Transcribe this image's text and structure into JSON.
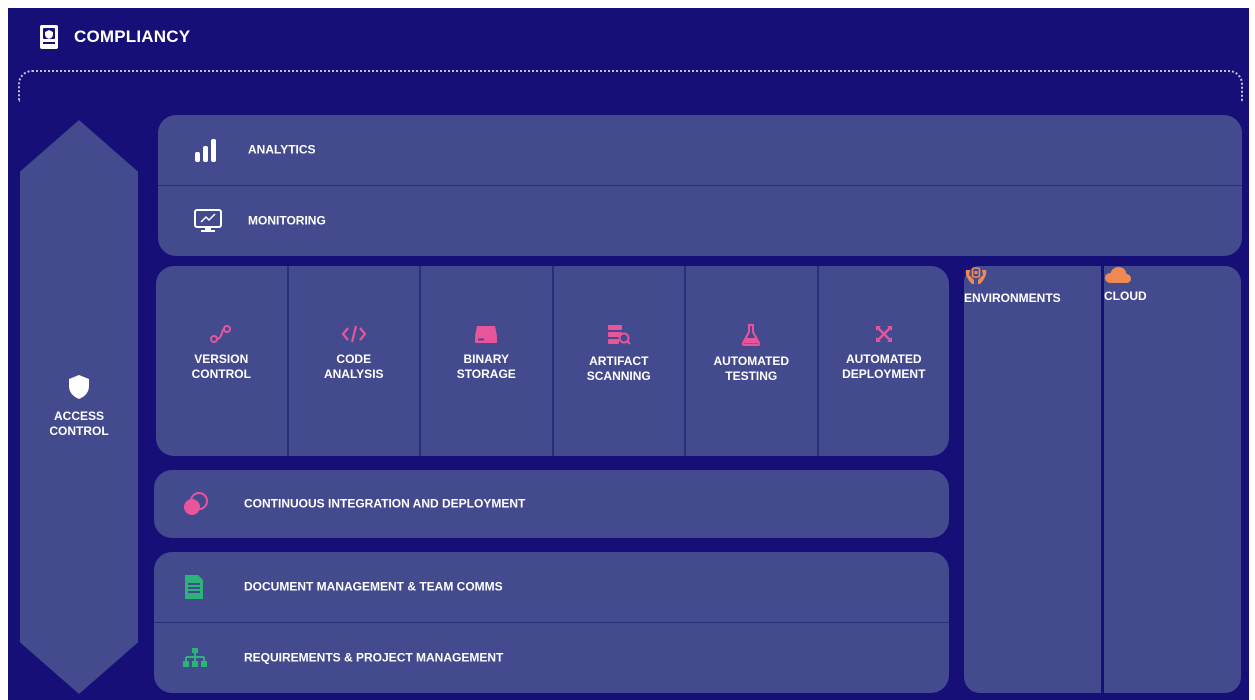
{
  "app": {
    "title": "COMPLIANCY"
  },
  "side": {
    "label": "ACCESS CONTROL"
  },
  "top_rows": [
    {
      "label": "ANALYTICS",
      "icon": "bar-chart-icon"
    },
    {
      "label": "MONITORING",
      "icon": "monitor-icon"
    }
  ],
  "tools": [
    {
      "label": "VERSION CONTROL",
      "icon": "branch-icon"
    },
    {
      "label": "CODE ANALYSIS",
      "icon": "code-icon"
    },
    {
      "label": "BINARY STORAGE",
      "icon": "storage-icon"
    },
    {
      "label": "ARTIFACT SCANNING",
      "icon": "scan-icon"
    },
    {
      "label": "AUTOMATED TESTING",
      "icon": "flask-icon"
    },
    {
      "label": "AUTOMATED DEPLOYMENT",
      "icon": "arrows-icon"
    }
  ],
  "ci": {
    "label": "CONTINUOUS INTEGRATION AND DEPLOYMENT",
    "icon": "circles-icon"
  },
  "bottom_rows": [
    {
      "label": "DOCUMENT MANAGEMENT & TEAM COMMS",
      "icon": "document-icon"
    },
    {
      "label": "REQUIREMENTS & PROJECT MANAGEMENT",
      "icon": "hierarchy-icon"
    }
  ],
  "env": {
    "label": "ENVIRONMENTS",
    "icon": "hands-icon"
  },
  "cloud": {
    "label": "CLOUD",
    "icon": "cloud-icon"
  },
  "colors": {
    "background": "#170f78",
    "panel": "#434b8e",
    "pink": "#e8559a",
    "orange": "#f08a55",
    "green": "#2cb37a"
  }
}
